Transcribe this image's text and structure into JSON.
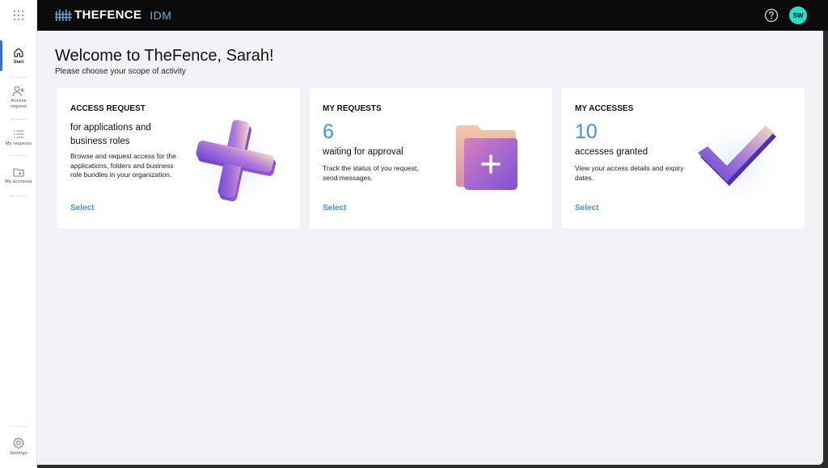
{
  "header": {
    "brand": "THEFENCE",
    "product": "IDM",
    "avatar_initials": "SW"
  },
  "sidebar": {
    "items": [
      {
        "label": "Start",
        "icon": "home-icon"
      },
      {
        "label": "Access request",
        "icon": "add-user-icon"
      },
      {
        "label": "My requests",
        "icon": "list-icon"
      },
      {
        "label": "My accesses",
        "icon": "folder-icon"
      }
    ],
    "settings": {
      "label": "Settings",
      "icon": "gear-icon"
    }
  },
  "page": {
    "title": "Welcome to TheFence, Sarah!",
    "subtitle": "Please choose your scope of activity"
  },
  "cards": [
    {
      "heading": "ACCESS REQUEST",
      "line": "for applications and business roles",
      "description": "Browse and request access for the applications, folders and business role bundles in your organization.",
      "link": "Select"
    },
    {
      "heading": "MY REQUESTS",
      "number": "6",
      "line": "waiting for approval",
      "description": "Track the status of you request, send messages.",
      "link": "Select"
    },
    {
      "heading": "MY ACCESSES",
      "number": "10",
      "line": "accesses granted",
      "description": "View your access details and expiry dates.",
      "link": "Select"
    }
  ],
  "colors": {
    "accent": "#3b96e0",
    "avatar": "#22e2cd",
    "topbar": "#0b0b0b",
    "background": "#f2f3f7"
  }
}
